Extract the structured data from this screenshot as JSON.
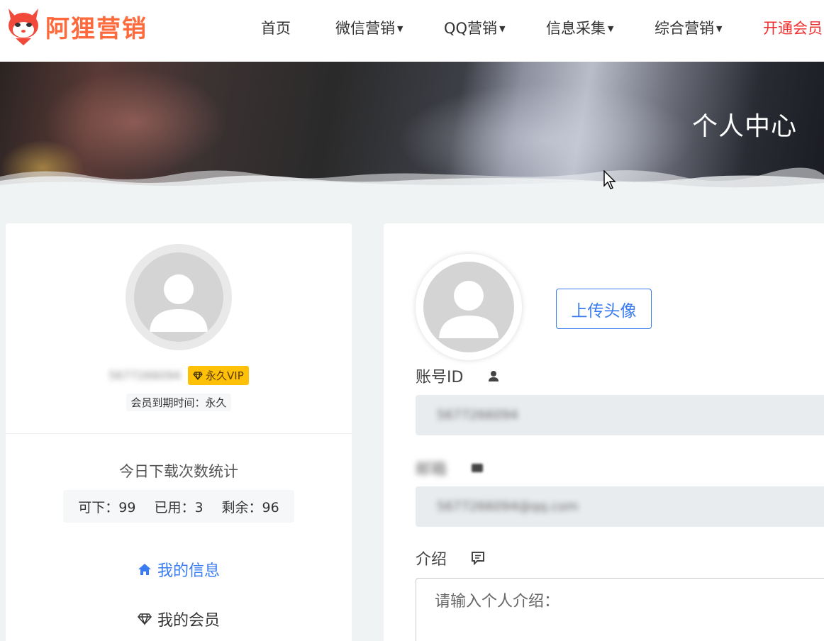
{
  "header": {
    "logo_text": "阿狸营销",
    "nav": [
      {
        "label": "首页",
        "dropdown": false
      },
      {
        "label": "微信营销",
        "dropdown": true
      },
      {
        "label": "QQ营销",
        "dropdown": true
      },
      {
        "label": "信息采集",
        "dropdown": true
      },
      {
        "label": "综合营销",
        "dropdown": true
      },
      {
        "label": "开通会员",
        "dropdown": false
      }
    ]
  },
  "banner": {
    "title": "个人中心"
  },
  "profile": {
    "username": "5677266094",
    "vip_badge": "永久VIP",
    "expire_text": "会员到期时间：永久"
  },
  "stats": {
    "title": "今日下载次数统计",
    "available": "可下：99",
    "used": "已用：3",
    "remaining": "剩余：96"
  },
  "menu": [
    {
      "label": "我的信息",
      "icon": "home-icon",
      "active": true
    },
    {
      "label": "我的会员",
      "icon": "diamond-icon",
      "active": false
    }
  ],
  "form": {
    "upload_label": "上传头像",
    "account_id_label": "账号ID",
    "account_id_value": "5677266094",
    "email_label": "邮箱",
    "email_value": "5677266094@qq.com",
    "intro_label": "介绍",
    "intro_placeholder": "请输入个人介绍："
  },
  "colors": {
    "brand": "#ff6a3d",
    "accent": "#3a7bf0",
    "vip": "#ffc107",
    "nav_highlight": "#f23030"
  }
}
